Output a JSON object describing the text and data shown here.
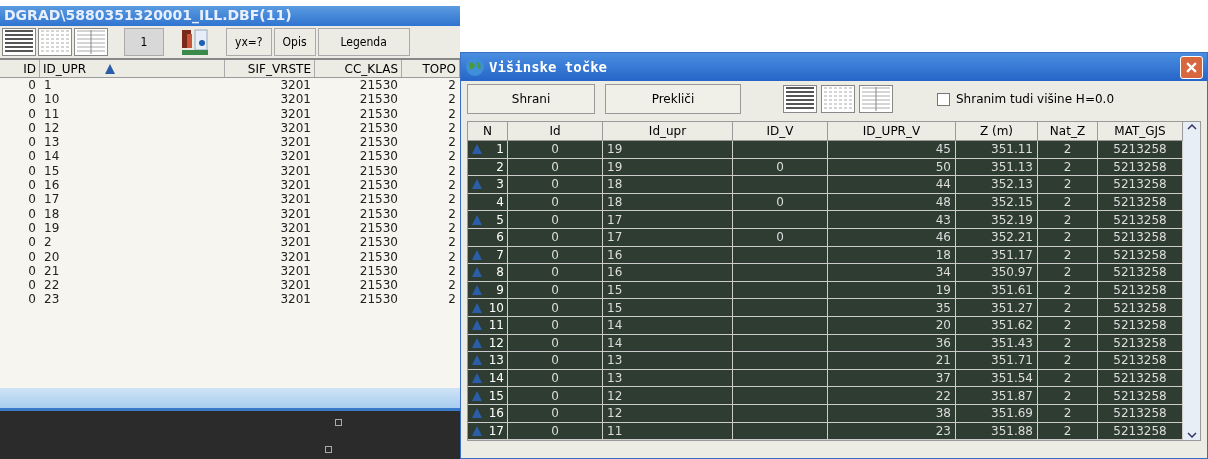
{
  "main_window": {
    "title": "DGRAD\\5880351320001_ILL.DBF(11)",
    "toolbar": {
      "page": "1",
      "buttons": [
        "yx=?",
        "Opis",
        "Legenda"
      ]
    },
    "table": {
      "columns": [
        {
          "label": "ID",
          "sorted": false
        },
        {
          "label": "ID_UPR",
          "sorted": true
        },
        {
          "label": "SIF_VRSTE",
          "sorted": false
        },
        {
          "label": "CC_KLAS",
          "sorted": false
        },
        {
          "label": "TOPO",
          "sorted": false
        }
      ],
      "rows": [
        [
          "0",
          "1",
          "3201",
          "21530",
          "2"
        ],
        [
          "0",
          "10",
          "3201",
          "21530",
          "2"
        ],
        [
          "0",
          "11",
          "3201",
          "21530",
          "2"
        ],
        [
          "0",
          "12",
          "3201",
          "21530",
          "2"
        ],
        [
          "0",
          "13",
          "3201",
          "21530",
          "2"
        ],
        [
          "0",
          "14",
          "3201",
          "21530",
          "2"
        ],
        [
          "0",
          "15",
          "3201",
          "21530",
          "2"
        ],
        [
          "0",
          "16",
          "3201",
          "21530",
          "2"
        ],
        [
          "0",
          "17",
          "3201",
          "21530",
          "2"
        ],
        [
          "0",
          "18",
          "3201",
          "21530",
          "2"
        ],
        [
          "0",
          "19",
          "3201",
          "21530",
          "2"
        ],
        [
          "0",
          "2",
          "3201",
          "21530",
          "2"
        ],
        [
          "0",
          "20",
          "3201",
          "21530",
          "2"
        ],
        [
          "0",
          "21",
          "3201",
          "21530",
          "2"
        ],
        [
          "0",
          "22",
          "3201",
          "21530",
          "2"
        ],
        [
          "0",
          "23",
          "3201",
          "21530",
          "2"
        ]
      ]
    }
  },
  "dialog": {
    "title": "Višinske točke",
    "buttons": [
      "Shrani",
      "Prekliči"
    ],
    "checkbox": {
      "label": "Shranim tudi višine H=0.0",
      "checked": false
    },
    "table": {
      "columns": [
        "N",
        "Id",
        "Id_upr",
        "ID_V",
        "ID_UPR_V",
        "Z (m)",
        "Nat_Z",
        "MAT_GJS"
      ],
      "rows": [
        {
          "marked": true,
          "cells": [
            "1",
            "0",
            "19",
            "",
            "45",
            "351.11",
            "2",
            "5213258"
          ]
        },
        {
          "marked": false,
          "cells": [
            "2",
            "0",
            "19",
            "0",
            "50",
            "351.13",
            "2",
            "5213258"
          ]
        },
        {
          "marked": true,
          "cells": [
            "3",
            "0",
            "18",
            "",
            "44",
            "352.13",
            "2",
            "5213258"
          ]
        },
        {
          "marked": false,
          "cells": [
            "4",
            "0",
            "18",
            "0",
            "48",
            "352.15",
            "2",
            "5213258"
          ]
        },
        {
          "marked": true,
          "cells": [
            "5",
            "0",
            "17",
            "",
            "43",
            "352.19",
            "2",
            "5213258"
          ]
        },
        {
          "marked": false,
          "cells": [
            "6",
            "0",
            "17",
            "0",
            "46",
            "352.21",
            "2",
            "5213258"
          ]
        },
        {
          "marked": true,
          "cells": [
            "7",
            "0",
            "16",
            "",
            "18",
            "351.17",
            "2",
            "5213258"
          ]
        },
        {
          "marked": true,
          "cells": [
            "8",
            "0",
            "16",
            "",
            "34",
            "350.97",
            "2",
            "5213258"
          ]
        },
        {
          "marked": true,
          "cells": [
            "9",
            "0",
            "15",
            "",
            "19",
            "351.61",
            "2",
            "5213258"
          ]
        },
        {
          "marked": true,
          "cells": [
            "10",
            "0",
            "15",
            "",
            "35",
            "351.27",
            "2",
            "5213258"
          ]
        },
        {
          "marked": true,
          "cells": [
            "11",
            "0",
            "14",
            "",
            "20",
            "351.62",
            "2",
            "5213258"
          ]
        },
        {
          "marked": true,
          "cells": [
            "12",
            "0",
            "14",
            "",
            "36",
            "351.43",
            "2",
            "5213258"
          ]
        },
        {
          "marked": true,
          "cells": [
            "13",
            "0",
            "13",
            "",
            "21",
            "351.71",
            "2",
            "5213258"
          ]
        },
        {
          "marked": true,
          "cells": [
            "14",
            "0",
            "13",
            "",
            "37",
            "351.54",
            "2",
            "5213258"
          ]
        },
        {
          "marked": true,
          "cells": [
            "15",
            "0",
            "12",
            "",
            "22",
            "351.87",
            "2",
            "5213258"
          ]
        },
        {
          "marked": true,
          "cells": [
            "16",
            "0",
            "12",
            "",
            "38",
            "351.69",
            "2",
            "5213258"
          ]
        },
        {
          "marked": true,
          "cells": [
            "17",
            "0",
            "11",
            "",
            "23",
            "351.88",
            "2",
            "5213258"
          ]
        }
      ]
    }
  }
}
